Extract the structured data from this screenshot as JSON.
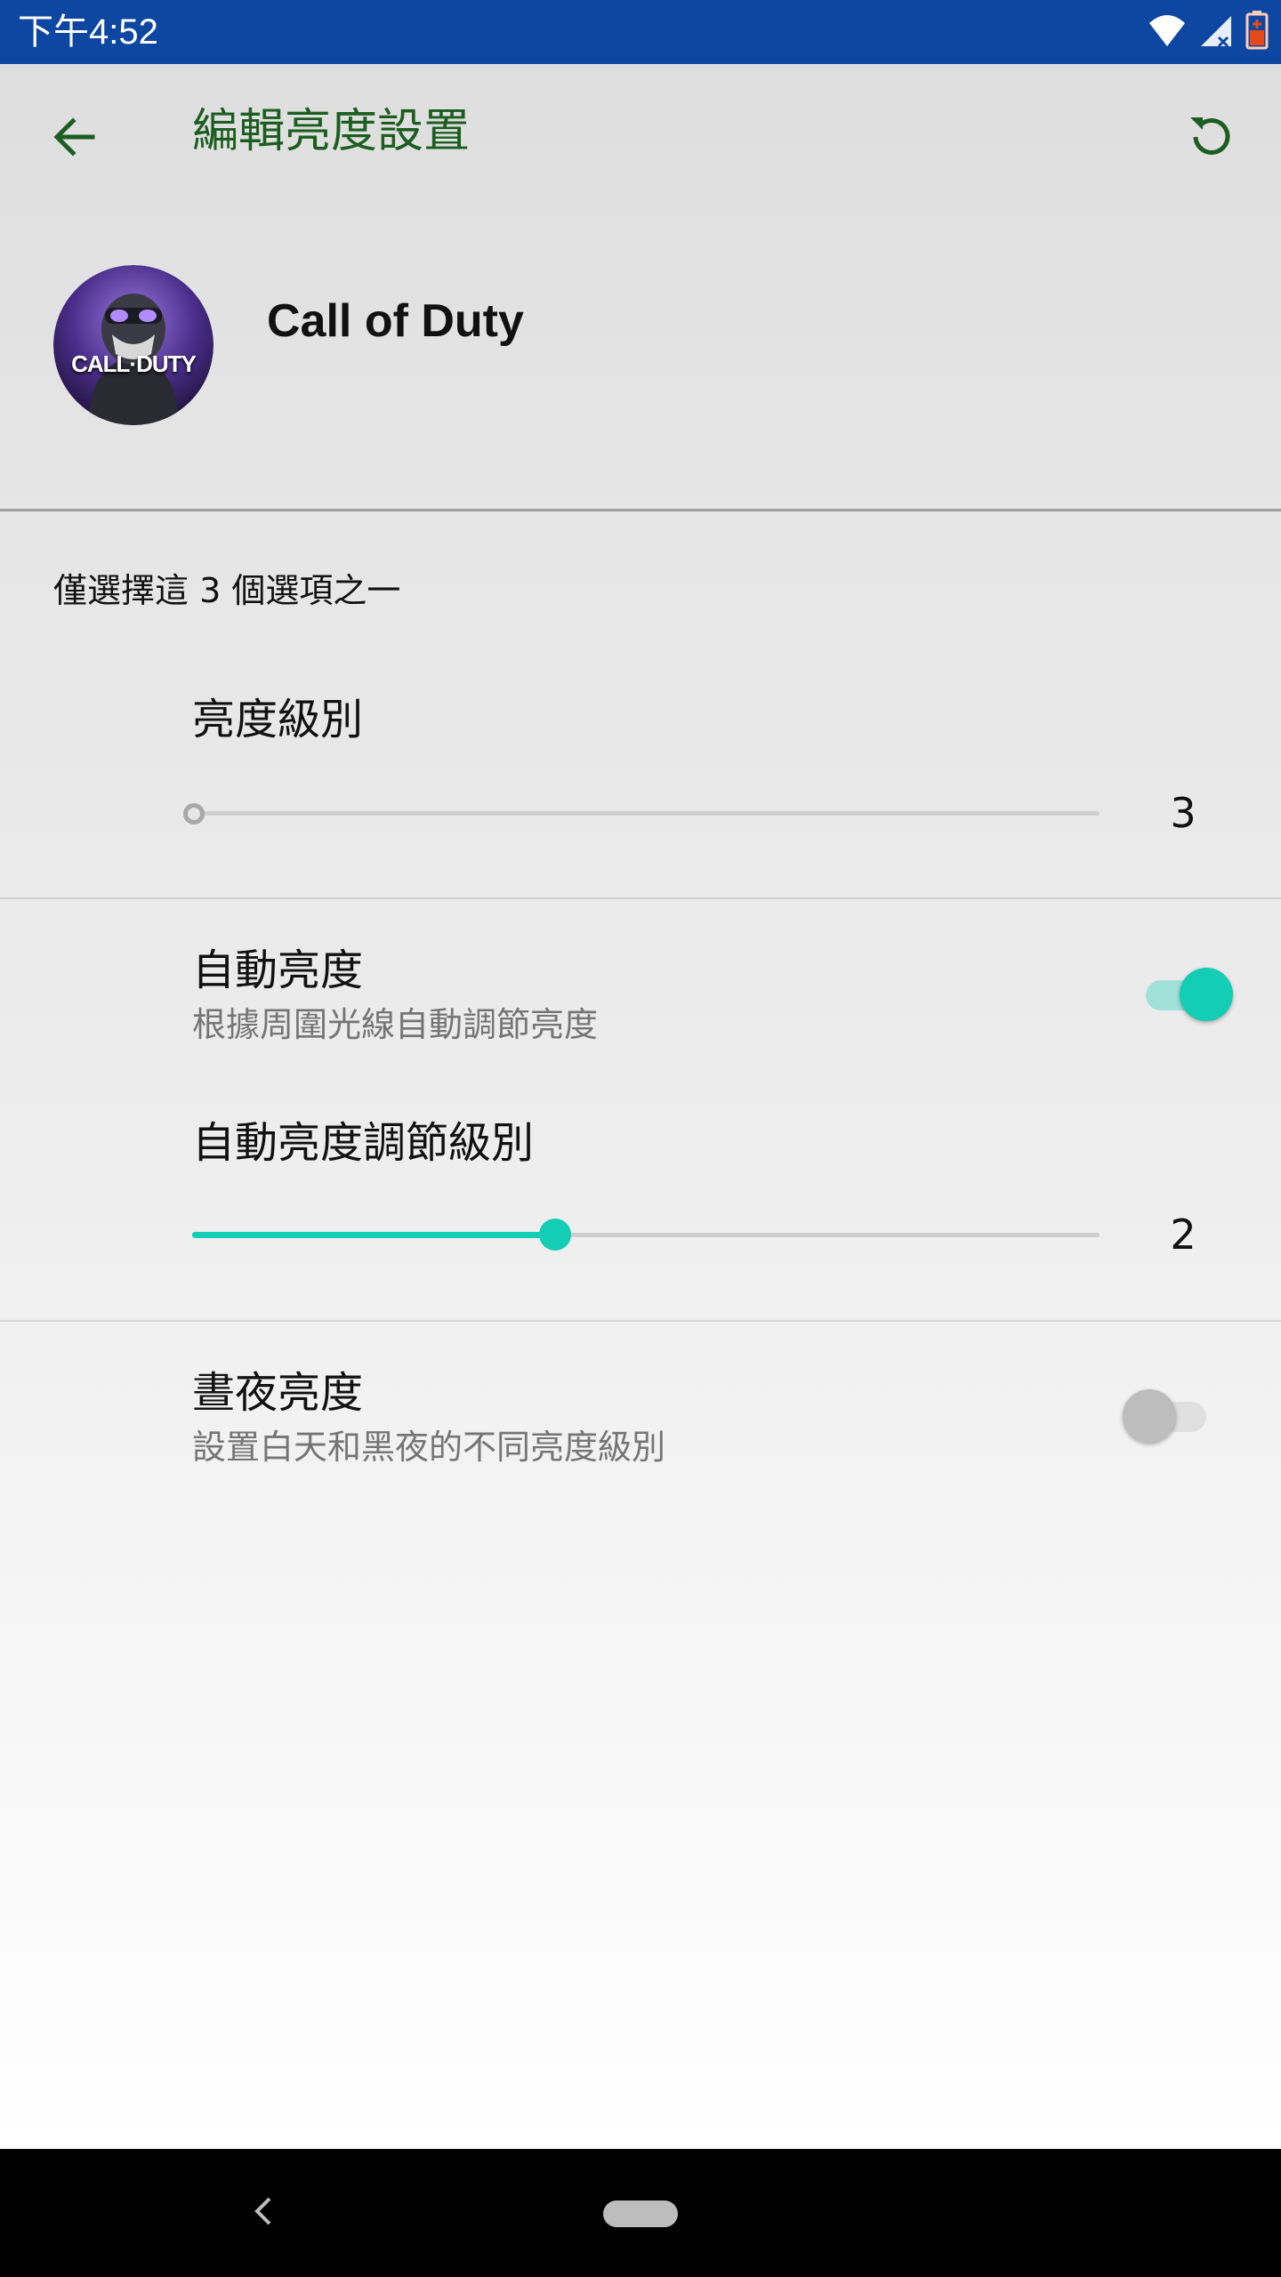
{
  "status_bar": {
    "time": "下午4:52",
    "icons": [
      "wifi-icon",
      "cell-signal-icon",
      "battery-icon"
    ]
  },
  "app_bar": {
    "title": "編輯亮度設置",
    "back_icon": "arrow-back-icon",
    "reset_icon": "refresh-icon"
  },
  "app": {
    "name": "Call of Duty",
    "avatar_logo_text": "CALL·DUTY"
  },
  "options_hint": "僅選擇這 3 個選項之一",
  "brightness_level": {
    "label": "亮度級別",
    "value": "3",
    "enabled": false,
    "fraction": 0.0
  },
  "auto_brightness": {
    "title": "自動亮度",
    "subtitle": "根據周圍光線自動調節亮度",
    "on": true
  },
  "auto_brightness_adjust": {
    "label": "自動亮度調節級別",
    "value": "2",
    "fraction": 0.4
  },
  "day_night_brightness": {
    "title": "晝夜亮度",
    "subtitle": "設置白天和黑夜的不同亮度級別",
    "on": false,
    "enabled": false
  },
  "colors": {
    "status_bar": "#0d47a1",
    "title_green": "#1b5e20",
    "accent_teal": "#14cdb5",
    "disabled_text": "#b2b2b2",
    "nav_bar": "#000000"
  },
  "nav_bar": {
    "back_icon": "nav-back-icon",
    "home_icon": "home-pill-icon"
  }
}
